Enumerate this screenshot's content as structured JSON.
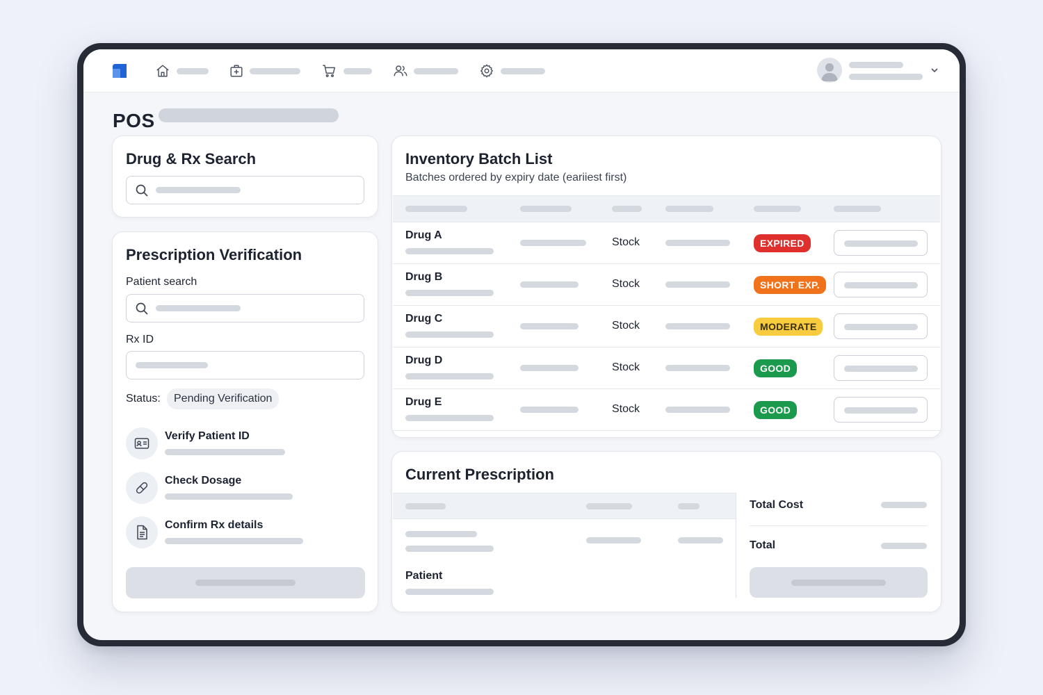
{
  "page": {
    "title": "POS"
  },
  "drug_search": {
    "title": "Drug & Rx Search"
  },
  "prescription": {
    "title": "Prescription Verification",
    "patient_search_label": "Patient search",
    "rx_id_label": "Rx ID",
    "status_label": "Status:",
    "status_value": "Pending Verification",
    "steps": [
      {
        "title": "Verify Patient ID",
        "icon": "id-card-icon"
      },
      {
        "title": "Check Dosage",
        "icon": "pill-icon"
      },
      {
        "title": "Confirm Rx details",
        "icon": "document-icon"
      }
    ]
  },
  "inventory": {
    "title": "Inventory Batch List",
    "subtitle": "Batches ordered by expiry date (eariiest first)",
    "rows": [
      {
        "name": "Drug A",
        "stock": "Stock",
        "badge": "EXPIRED",
        "badge_color": "#e0302e"
      },
      {
        "name": "Drug B",
        "stock": "Stock",
        "badge": "SHORT EXP.",
        "badge_color": "#f0731c"
      },
      {
        "name": "Drug C",
        "stock": "Stock",
        "badge": "MODERATE",
        "badge_color": "#f8cc3e"
      },
      {
        "name": "Drug D",
        "stock": "Stock",
        "badge": "GOOD",
        "badge_color": "#1b9a4d"
      },
      {
        "name": "Drug E",
        "stock": "Stock",
        "badge": "GOOD",
        "badge_color": "#1b9a4d"
      }
    ]
  },
  "current_prescription": {
    "title": "Current Prescription",
    "patient_label": "Patient",
    "total_cost_label": "Total Cost",
    "total_label": "Total"
  },
  "colors": {
    "brand": "#1f63d6",
    "moderate_text": "#3a2f05"
  }
}
